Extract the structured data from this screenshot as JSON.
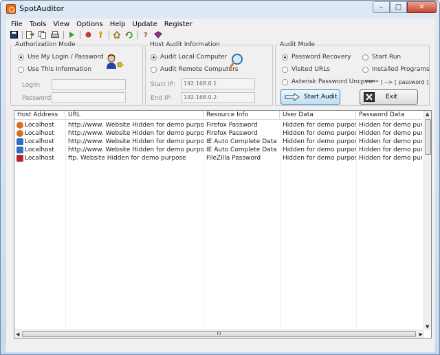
{
  "window": {
    "title": "SpotAuditor"
  },
  "menu": [
    "File",
    "Tools",
    "View",
    "Options",
    "Help",
    "Update",
    "Register"
  ],
  "auth": {
    "legend": "Authorization Mode",
    "opt1": "Use My Login / Password",
    "opt2": "Use This Information",
    "login_label": "Login:",
    "password_label": "Password:"
  },
  "host": {
    "legend": "Host Audit Information",
    "opt1": "Audit Local Computer",
    "opt2": "Audit Remote Computers",
    "start_label": "Start IP:",
    "start_value": "192.168.0.1",
    "end_label": "End IP:",
    "end_value": "192.168.0.2"
  },
  "mode": {
    "legend": "Audit Mode",
    "opt1": "Password Recovery",
    "opt2": "Start Run",
    "opt3": "Visited URLs",
    "opt4": "Installed Programs",
    "opt5": "Asterisk Password Uncover",
    "asterisk_hint": "[ ***** ] --> [ password ]",
    "start_button": "Start Audit",
    "exit_button": "Exit"
  },
  "table": {
    "columns": [
      "Host Address",
      "URL",
      "Resource Info",
      "User Data",
      "Password Data"
    ],
    "rows": [
      {
        "icon": "firefox-icon",
        "host": "Localhost",
        "url": "http://www. Website Hidden for demo purpose",
        "resource": "Firefox Password",
        "user": "Hidden for demo purpose",
        "password": "Hidden for demo purpo"
      },
      {
        "icon": "firefox-icon",
        "host": "Localhost",
        "url": "http://www. Website Hidden for demo purpose",
        "resource": "Firefox Password",
        "user": "Hidden for demo purpose",
        "password": "Hidden for demo purpo"
      },
      {
        "icon": "ie-icon",
        "host": "Localhost",
        "url": "http://www. Website Hidden for demo purpose",
        "resource": "IE Auto Complete Data",
        "user": "Hidden for demo purpose",
        "password": "Hidden for demo purpo"
      },
      {
        "icon": "ie-icon",
        "host": "Localhost",
        "url": "http://www. Website Hidden for demo purpose",
        "resource": "IE Auto Complete Data",
        "user": "Hidden for demo purpose",
        "password": "Hidden for demo purpo"
      },
      {
        "icon": "filezilla-icon",
        "host": "Localhost",
        "url": "ftp. Website Hidden for demo purpose",
        "resource": "FileZilla Password",
        "user": "Hidden for demo purpose",
        "password": "Hidden for demo purpo"
      }
    ]
  },
  "colors": {
    "firefox": "#d86d1e",
    "ie": "#2a6fc2",
    "filezilla": "#b8262b"
  },
  "scroll": {
    "h_grip": "III"
  }
}
